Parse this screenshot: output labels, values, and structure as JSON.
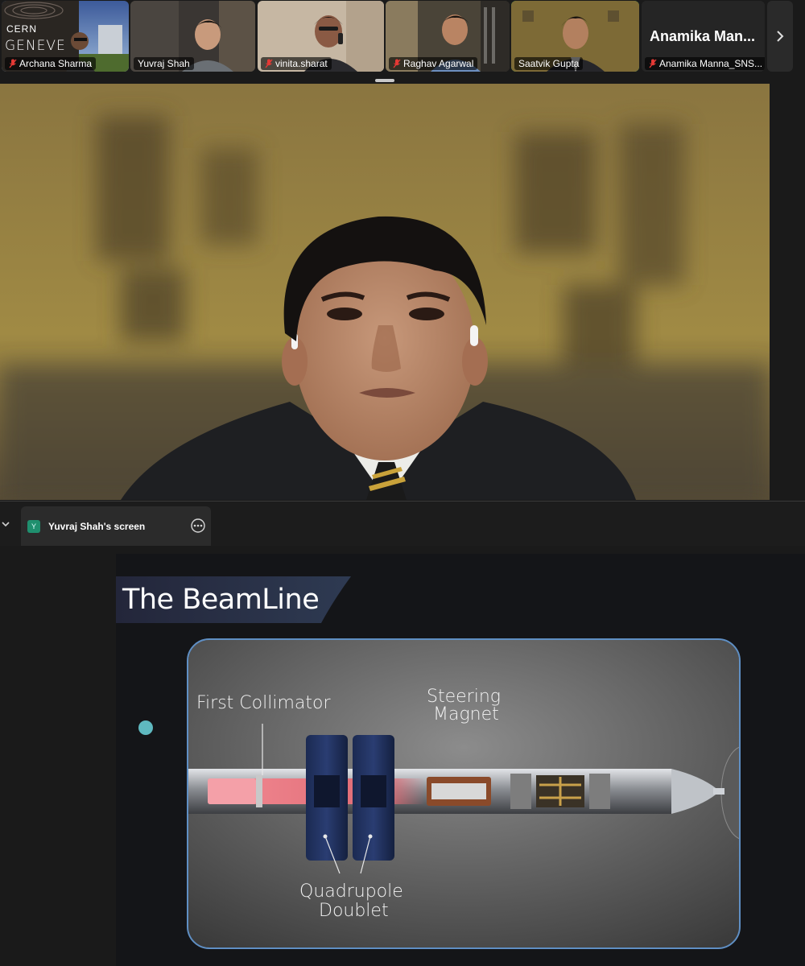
{
  "participants": [
    {
      "name": "Archana Sharma",
      "muted": true
    },
    {
      "name": "Yuvraj Shah",
      "muted": false
    },
    {
      "name": "vinita.sharat",
      "muted": true
    },
    {
      "name": "Raghav Agarwal",
      "muted": true
    },
    {
      "name": "Saatvik Gupta",
      "muted": false,
      "active": true
    },
    {
      "name": "Anamika Manna_SNS...",
      "muted": true,
      "display_name": "Anamika Man..."
    }
  ],
  "archana_background": {
    "line1": "CERN",
    "line2": "GENEVE"
  },
  "share": {
    "avatar_initial": "Y",
    "title": "Yuvraj Shah's screen"
  },
  "slide": {
    "title": "The BeamLine",
    "labels": {
      "first_collimator": "First Collimator",
      "steering_magnet_1": "Steering",
      "steering_magnet_2": "Magnet",
      "quadrupole_1": "Quadrupole",
      "quadrupole_2": "Doublet"
    }
  },
  "colors": {
    "active_speaker_outline": "#23d160",
    "bullet": "#5fb9c0",
    "diagram_border": "#5f8fc4"
  }
}
